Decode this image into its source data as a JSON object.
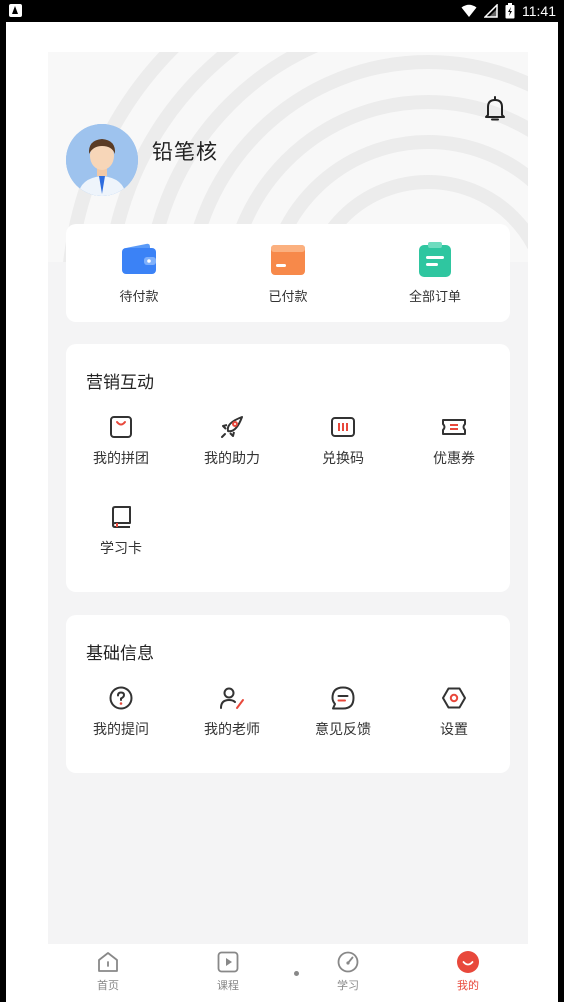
{
  "status_bar": {
    "time": "11:41",
    "battery_icon": "battery-charging-icon",
    "signal_icon": "signal-icon",
    "wifi_icon": "wifi-icon"
  },
  "profile": {
    "username": "铅笔核",
    "avatar_icon": "user-avatar",
    "bell_icon": "bell-icon"
  },
  "orders": [
    {
      "label": "待付款",
      "icon": "wallet-icon",
      "color": "#3b82f6"
    },
    {
      "label": "已付款",
      "icon": "card-icon",
      "color": "#f7894a"
    },
    {
      "label": "全部订单",
      "icon": "clipboard-icon",
      "color": "#2fc6a0"
    }
  ],
  "marketing": {
    "title": "营销互动",
    "items": [
      {
        "label": "我的拼团",
        "icon": "bag-icon"
      },
      {
        "label": "我的助力",
        "icon": "rocket-icon"
      },
      {
        "label": "兑换码",
        "icon": "barcode-icon"
      },
      {
        "label": "优惠券",
        "icon": "ticket-icon"
      },
      {
        "label": "学习卡",
        "icon": "book-card-icon"
      }
    ]
  },
  "basic_info": {
    "title": "基础信息",
    "items": [
      {
        "label": "我的提问",
        "icon": "question-icon"
      },
      {
        "label": "我的老师",
        "icon": "teacher-icon"
      },
      {
        "label": "意见反馈",
        "icon": "feedback-icon"
      },
      {
        "label": "设置",
        "icon": "settings-icon"
      }
    ]
  },
  "tabs": [
    {
      "label": "首页",
      "icon": "home-icon"
    },
    {
      "label": "课程",
      "icon": "play-icon"
    },
    {
      "label": "学习",
      "icon": "gauge-icon"
    },
    {
      "label": "我的",
      "icon": "smile-icon",
      "active": true
    }
  ],
  "colors": {
    "accent": "#e8483b",
    "background": "#f4f4f5",
    "card": "#ffffff",
    "icon": "#333333"
  }
}
